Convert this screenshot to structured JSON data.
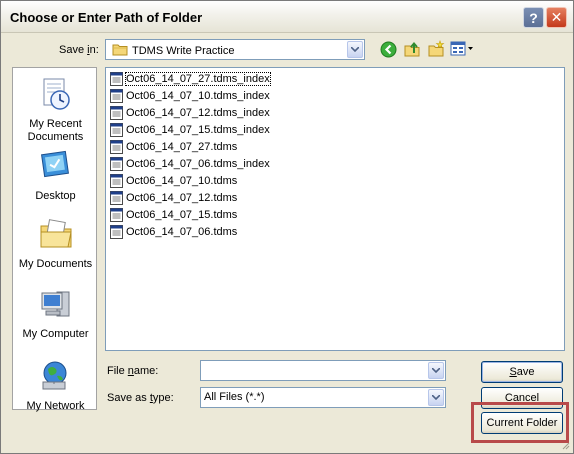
{
  "window": {
    "title": "Choose or Enter Path of Folder",
    "help_label": "?",
    "close_label": "✕"
  },
  "toolbar": {
    "save_in_label_pre": "Save ",
    "save_in_label_ul": "i",
    "save_in_label_post": "n:",
    "current_folder": "TDMS Write Practice",
    "icons": [
      "back-icon",
      "up-folder-icon",
      "new-folder-icon",
      "views-menu-icon"
    ]
  },
  "places": [
    {
      "label": "My Recent Documents",
      "icon": "recent-documents-icon"
    },
    {
      "label": "Desktop",
      "icon": "desktop-icon"
    },
    {
      "label": "My Documents",
      "icon": "my-documents-icon"
    },
    {
      "label": "My Computer",
      "icon": "my-computer-icon"
    },
    {
      "label": "My Network",
      "icon": "my-network-icon"
    }
  ],
  "files": [
    "Oct06_14_07_27.tdms_index",
    "Oct06_14_07_10.tdms_index",
    "Oct06_14_07_12.tdms_index",
    "Oct06_14_07_15.tdms_index",
    "Oct06_14_07_27.tdms",
    "Oct06_14_07_06.tdms_index",
    "Oct06_14_07_10.tdms",
    "Oct06_14_07_12.tdms",
    "Oct06_14_07_15.tdms",
    "Oct06_14_07_06.tdms"
  ],
  "form": {
    "file_name_label_pre": "File ",
    "file_name_label_ul": "n",
    "file_name_label_post": "ame:",
    "file_name_value": "",
    "save_as_type_label_pre": "Save as ",
    "save_as_type_label_ul": "t",
    "save_as_type_label_post": "ype:",
    "save_as_type_value": "All Files (*.*)"
  },
  "buttons": {
    "save_ul": "S",
    "save_rest": "ave",
    "cancel": "Cancel",
    "current_folder": "Current Folder"
  },
  "colors": {
    "highlight": "#b84a4a",
    "face": "#ece9d8"
  }
}
